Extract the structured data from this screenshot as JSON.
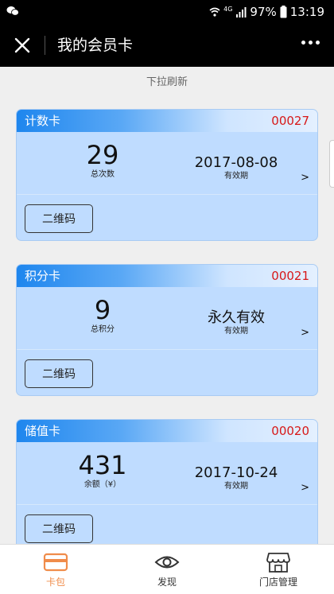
{
  "status_bar": {
    "app_icon": "wechat-icon",
    "network": "4G",
    "battery": "97%",
    "time": "13:19"
  },
  "navbar": {
    "title": "我的会员卡",
    "close_icon": "close-icon",
    "more_icon": "more-dots-icon"
  },
  "pull_hint": "下拉刷新",
  "cards": [
    {
      "type": "计数卡",
      "number": "00027",
      "metric_value": "29",
      "metric_label": "总次数",
      "expiry_value": "2017-08-08",
      "expiry_label": "有效期",
      "arrow": ">",
      "qr_button": "二维码"
    },
    {
      "type": "积分卡",
      "number": "00021",
      "metric_value": "9",
      "metric_label": "总积分",
      "expiry_value": "永久有效",
      "expiry_label": "有效期",
      "arrow": ">",
      "qr_button": "二维码"
    },
    {
      "type": "储值卡",
      "number": "00020",
      "metric_value": "431",
      "metric_label": "余额（¥）",
      "expiry_value": "2017-10-24",
      "expiry_label": "有效期",
      "arrow": ">",
      "qr_button": "二维码"
    }
  ],
  "tabbar": {
    "items": [
      {
        "label": "卡包",
        "icon": "card-wallet-icon",
        "active": true
      },
      {
        "label": "发现",
        "icon": "eye-icon",
        "active": false
      },
      {
        "label": "门店管理",
        "icon": "store-icon",
        "active": false
      }
    ]
  },
  "colors": {
    "accent": "#f08c4a",
    "card_number": "#d71818",
    "card_header": "#1e86ee",
    "card_body": "#bfdcff"
  }
}
